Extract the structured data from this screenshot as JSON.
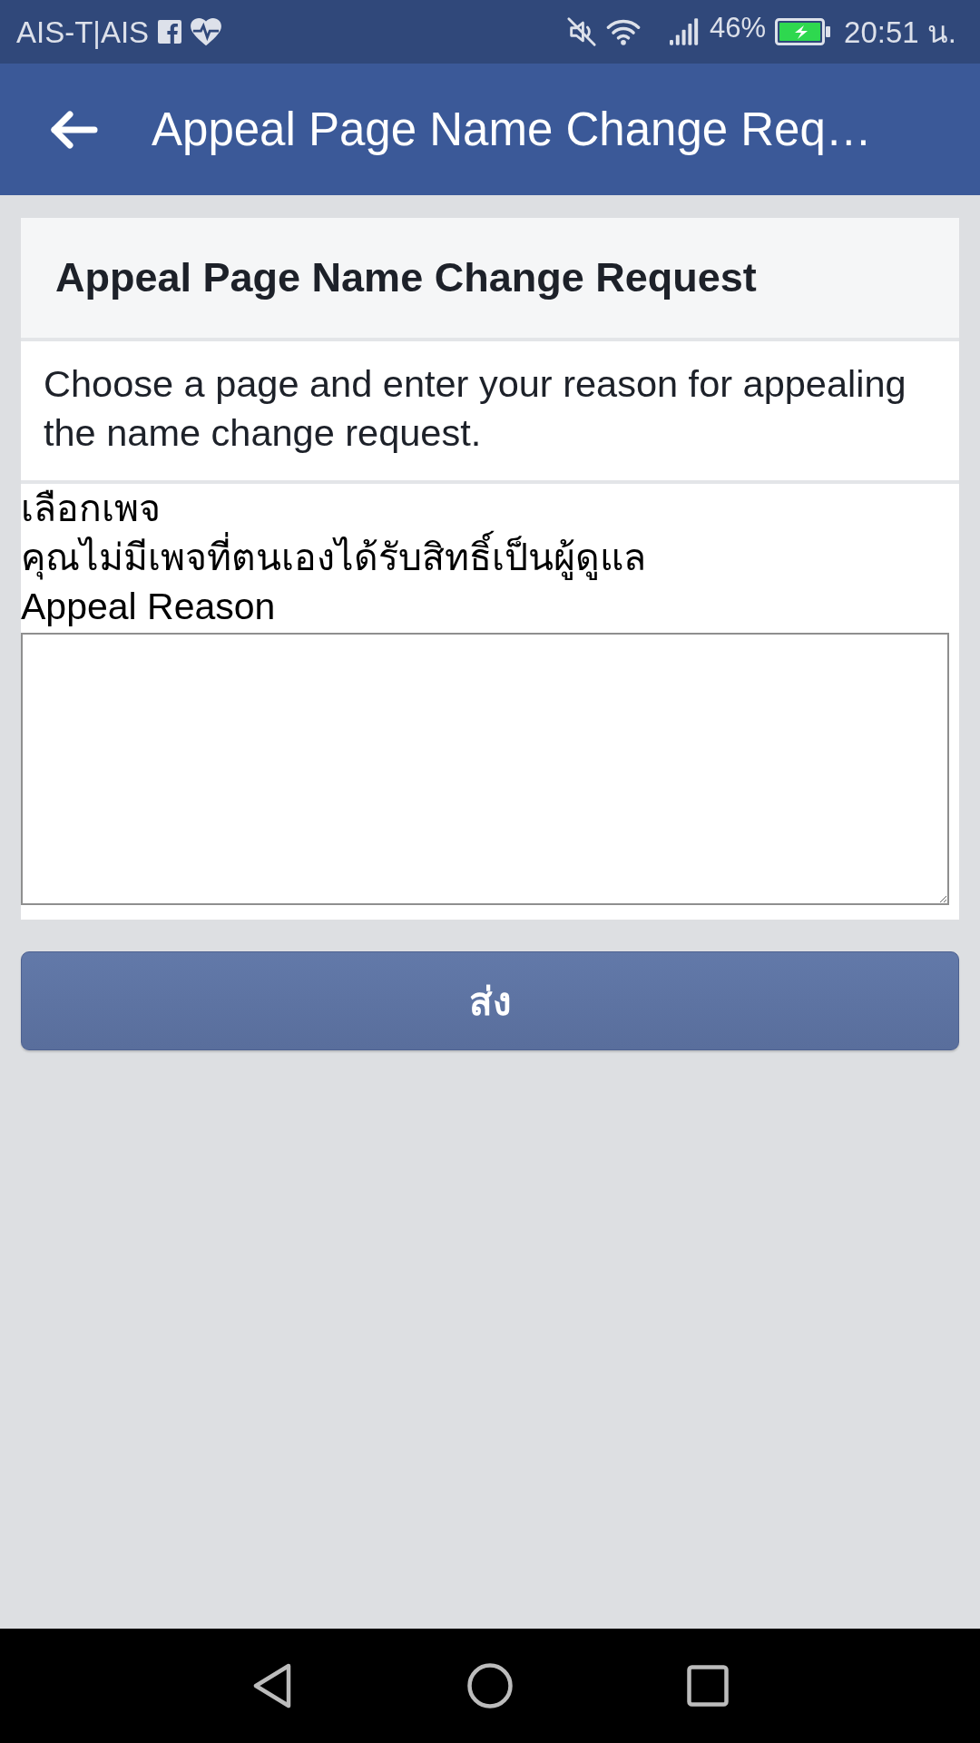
{
  "status_bar": {
    "carrier": "AIS-T|AIS",
    "battery_percent": "46%",
    "time": "20:51 น."
  },
  "app_bar": {
    "title": "Appeal Page Name Change Req…"
  },
  "card": {
    "title": "Appeal Page Name Change Request",
    "description": "Choose a page and enter your reason for appealing the name change request.",
    "page_label": "เลือกเพจ",
    "no_pages_message": "คุณไม่มีเพจที่ตนเองได้รับสิทธิ์เป็นผู้ดูแล",
    "reason_label": "Appeal Reason"
  },
  "submit_button": {
    "label": "ส่ง"
  }
}
